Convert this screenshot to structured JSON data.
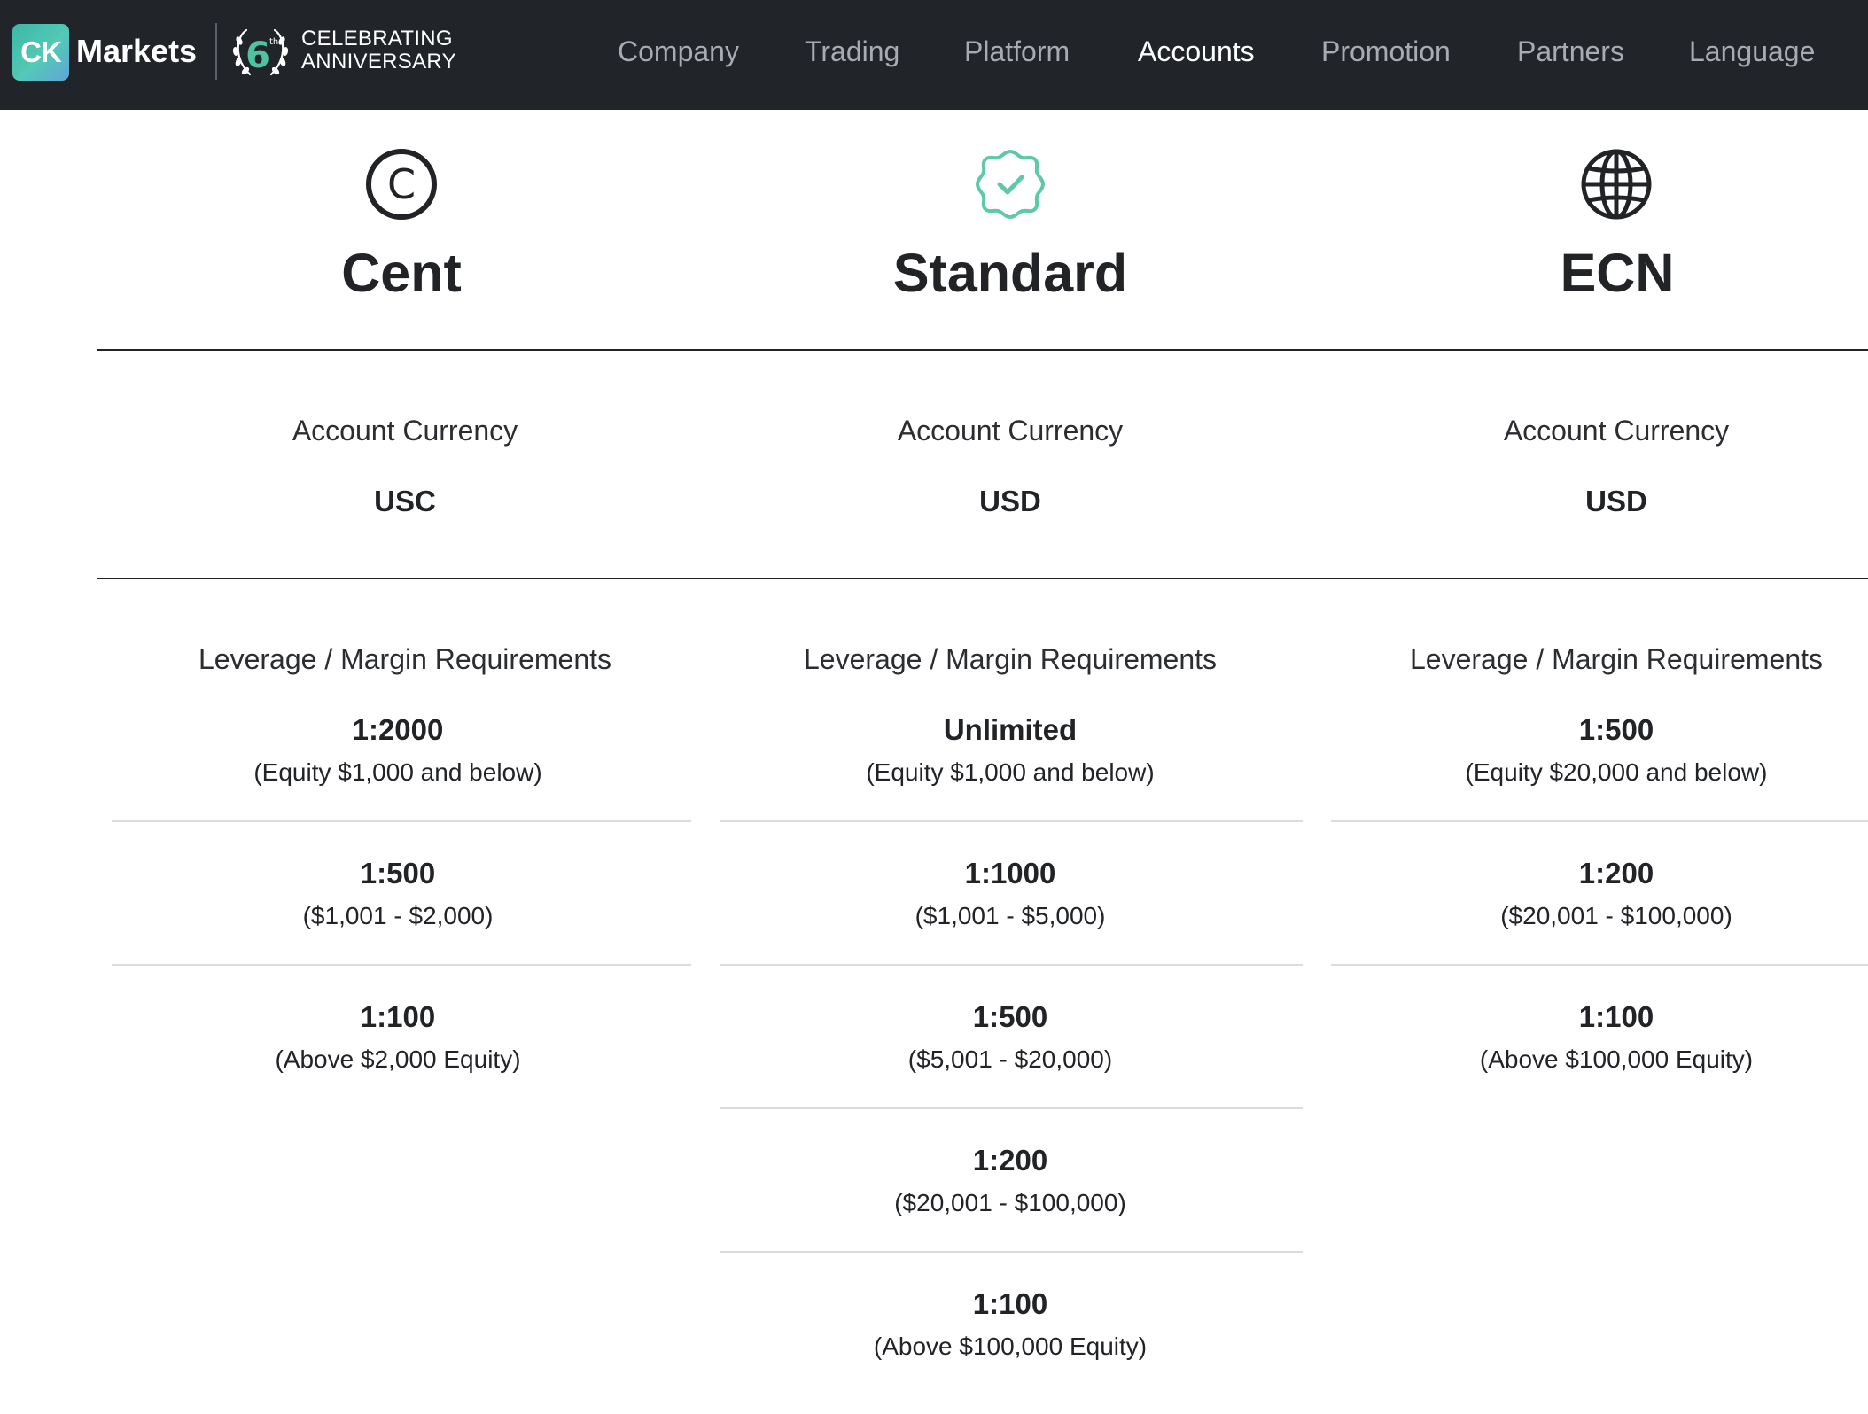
{
  "header": {
    "logo_text": "CK",
    "brand_name": "Markets",
    "anniversary": {
      "line1": "CELEBRATING",
      "line2": "ANNIVERSARY"
    },
    "nav_items": [
      "Company",
      "Trading",
      "Platform",
      "Accounts",
      "Promotion",
      "Partners",
      "Language"
    ],
    "active_nav": "Accounts"
  },
  "colors": {
    "accent": "#4fc3a1",
    "nav_bg": "#212429",
    "text": "#212326"
  },
  "accounts": [
    {
      "name": "Cent",
      "icon": "copyright-c-icon",
      "currency_label": "Account Currency",
      "currency": "USC",
      "leverage_label": "Leverage / Margin Requirements",
      "tiers": [
        {
          "ratio": "1:2000",
          "note": "(Equity $1,000 and below)"
        },
        {
          "ratio": "1:500",
          "note": "($1,001 - $2,000)"
        },
        {
          "ratio": "1:100",
          "note": "(Above $2,000 Equity)"
        }
      ]
    },
    {
      "name": "Standard",
      "icon": "verified-badge-icon",
      "currency_label": "Account Currency",
      "currency": "USD",
      "leverage_label": "Leverage / Margin Requirements",
      "tiers": [
        {
          "ratio": "Unlimited",
          "note": "(Equity $1,000 and below)"
        },
        {
          "ratio": "1:1000",
          "note": "($1,001 - $5,000)"
        },
        {
          "ratio": "1:500",
          "note": "($5,001 - $20,000)"
        },
        {
          "ratio": "1:200",
          "note": "($20,001 - $100,000)"
        },
        {
          "ratio": "1:100",
          "note": "(Above $100,000 Equity)"
        }
      ]
    },
    {
      "name": "ECN",
      "icon": "globe-icon",
      "currency_label": "Account Currency",
      "currency": "USD",
      "leverage_label": "Leverage / Margin Requirements",
      "tiers": [
        {
          "ratio": "1:500",
          "note": "(Equity $20,000 and below)"
        },
        {
          "ratio": "1:200",
          "note": "($20,001 - $100,000)"
        },
        {
          "ratio": "1:100",
          "note": "(Above $100,000 Equity)"
        }
      ]
    }
  ]
}
